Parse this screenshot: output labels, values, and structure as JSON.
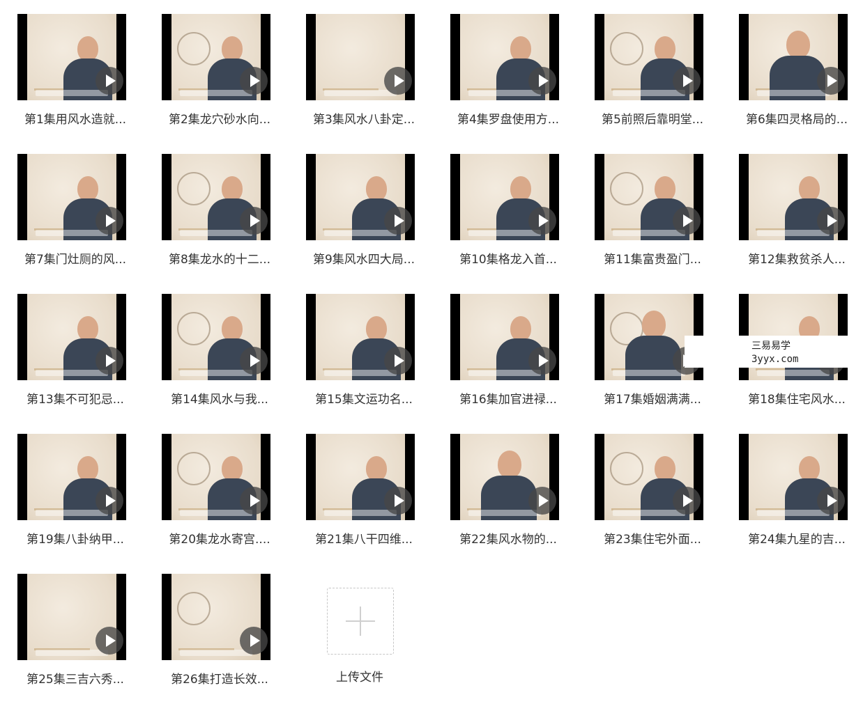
{
  "files": [
    {
      "name": "第1集用风水造就..."
    },
    {
      "name": "第2集龙穴砂水向..."
    },
    {
      "name": "第3集风水八卦定..."
    },
    {
      "name": "第4集罗盘使用方..."
    },
    {
      "name": "第5前照后靠明堂..."
    },
    {
      "name": "第6集四灵格局的..."
    },
    {
      "name": "第7集门灶厕的风..."
    },
    {
      "name": "第8集龙水的十二..."
    },
    {
      "name": "第9集风水四大局..."
    },
    {
      "name": "第10集格龙入首..."
    },
    {
      "name": "第11集富贵盈门..."
    },
    {
      "name": "第12集救贫杀人..."
    },
    {
      "name": "第13集不可犯忌..."
    },
    {
      "name": "第14集风水与我..."
    },
    {
      "name": "第15集文运功名..."
    },
    {
      "name": "第16集加官进禄..."
    },
    {
      "name": "第17集婚姻满满..."
    },
    {
      "name": "第18集住宅风水..."
    },
    {
      "name": "第19集八卦纳甲..."
    },
    {
      "name": "第20集龙水寄宫...."
    },
    {
      "name": "第21集八干四维..."
    },
    {
      "name": "第22集风水物的..."
    },
    {
      "name": "第23集住宅外面..."
    },
    {
      "name": "第24集九星的吉..."
    },
    {
      "name": "第25集三吉六秀..."
    },
    {
      "name": "第26集打造长效..."
    }
  ],
  "upload": {
    "label": "上传文件"
  },
  "watermark": {
    "line1": "三易易学",
    "line2": "3yyx.com"
  }
}
